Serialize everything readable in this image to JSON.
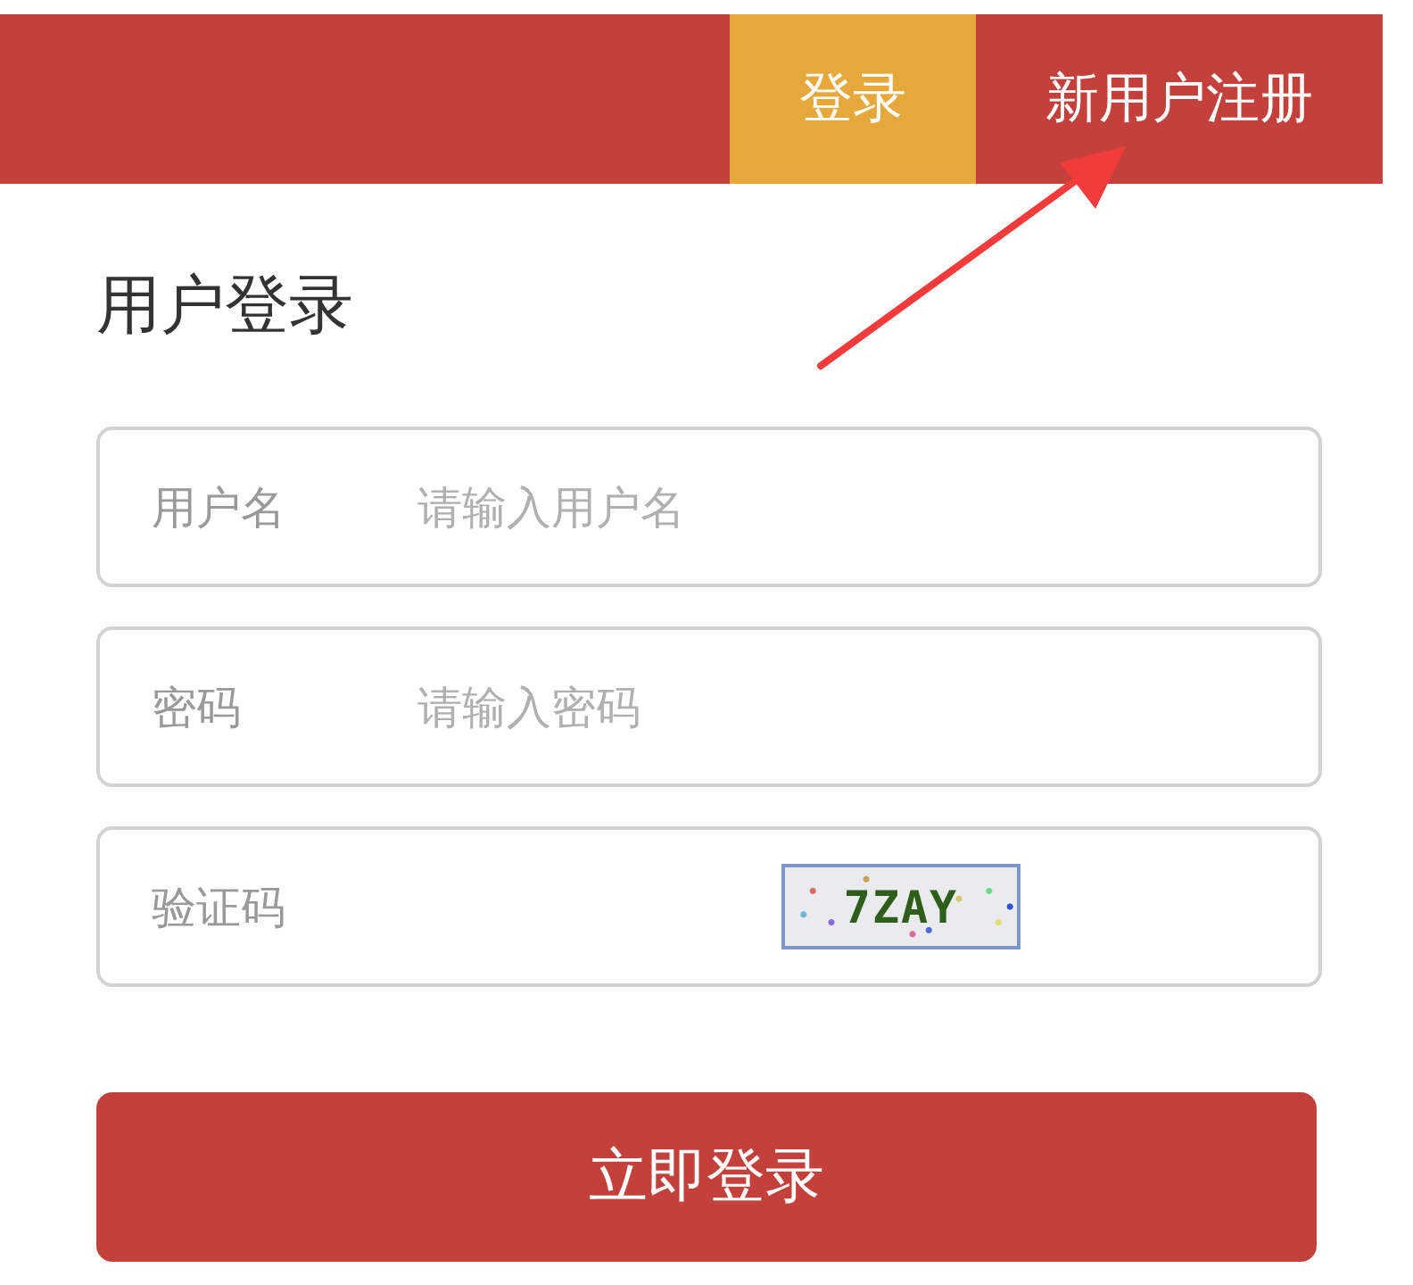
{
  "nav": {
    "tabs": [
      {
        "label": "登录",
        "selected": true
      },
      {
        "label": "新用户注册",
        "selected": false
      }
    ]
  },
  "title": "用户登录",
  "fields": [
    {
      "kind": "text",
      "label": "用户名",
      "placeholder": "请输入用户名"
    },
    {
      "kind": "password",
      "label": "密码",
      "placeholder": "请输入密码"
    },
    {
      "kind": "captcha",
      "label": "验证码",
      "captcha": "7ZAY"
    }
  ],
  "submit": {
    "label": "立即登录"
  }
}
